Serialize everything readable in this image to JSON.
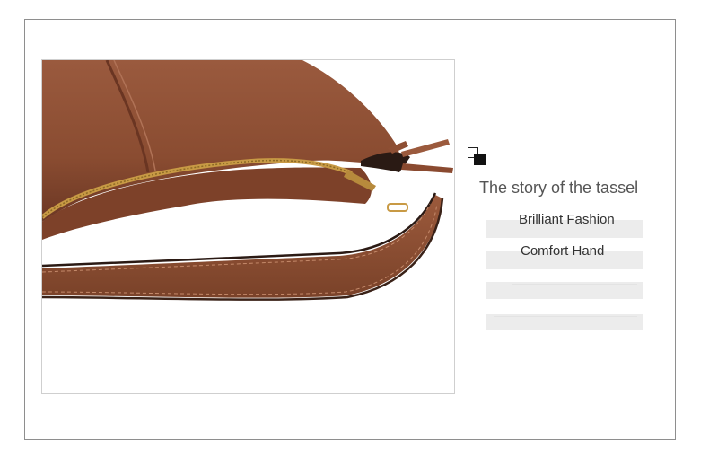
{
  "heading": "The story of the tassel",
  "features": [
    {
      "label": "Brilliant Fashion"
    },
    {
      "label": "Comfort Hand"
    },
    {
      "label": ""
    },
    {
      "label": ""
    }
  ],
  "colors": {
    "leather": "#8e4f34",
    "leather_dark": "#5e3020",
    "zipper_gold": "#c89a45",
    "frame": "#8e8e8e",
    "bar_fill": "#ececec"
  },
  "icons": {
    "corner_mark": "overlapping-squares-icon"
  }
}
